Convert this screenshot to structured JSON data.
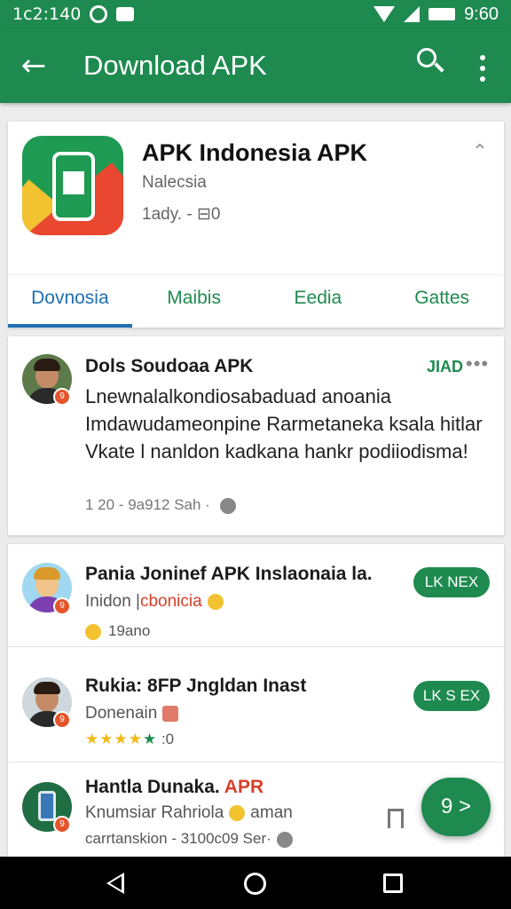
{
  "status": {
    "time_left": "1c2:140",
    "time_right": "9:60"
  },
  "appbar": {
    "title": "Download APK"
  },
  "app": {
    "name": "APK Indonesia APK",
    "subtitle": "Nalecsia",
    "meta": "1ady. - ⊟0",
    "tabs": [
      "Dovnosia",
      "Maibis",
      "Eedia",
      "Gattes"
    ]
  },
  "post": {
    "author": "Dols Soudoaa APK",
    "tag": "JIAD",
    "body": "Lnewnalalkondiosabaduad anoania Imdawudameonpine Rarmetaneka ksala hitlar Vkate l nanldon kadkana hankr podiiodisma!",
    "meta": "1 20 - 9a912 Sah ·"
  },
  "list": [
    {
      "title": "Pania Joninef APK Inslaonaia la.",
      "sub_a": "Inidon |",
      "sub_b": "cbonicia",
      "meta": "19ano",
      "button": "LK NEX"
    },
    {
      "title": "Rukia: 8FP Jngldan Inast",
      "sub_a": "Donenain",
      "meta": ":0",
      "stars": "★★★★",
      "star_green": "★",
      "button": "LK S EX"
    },
    {
      "title": "Hantla Dunaka.",
      "title_hl": "APR",
      "sub_a": "Knumsiar Rahriola",
      "sub_b": "aman",
      "meta": "carrtanskion - 3100c09 Ser·"
    }
  ],
  "fab": {
    "label": "9 >"
  }
}
